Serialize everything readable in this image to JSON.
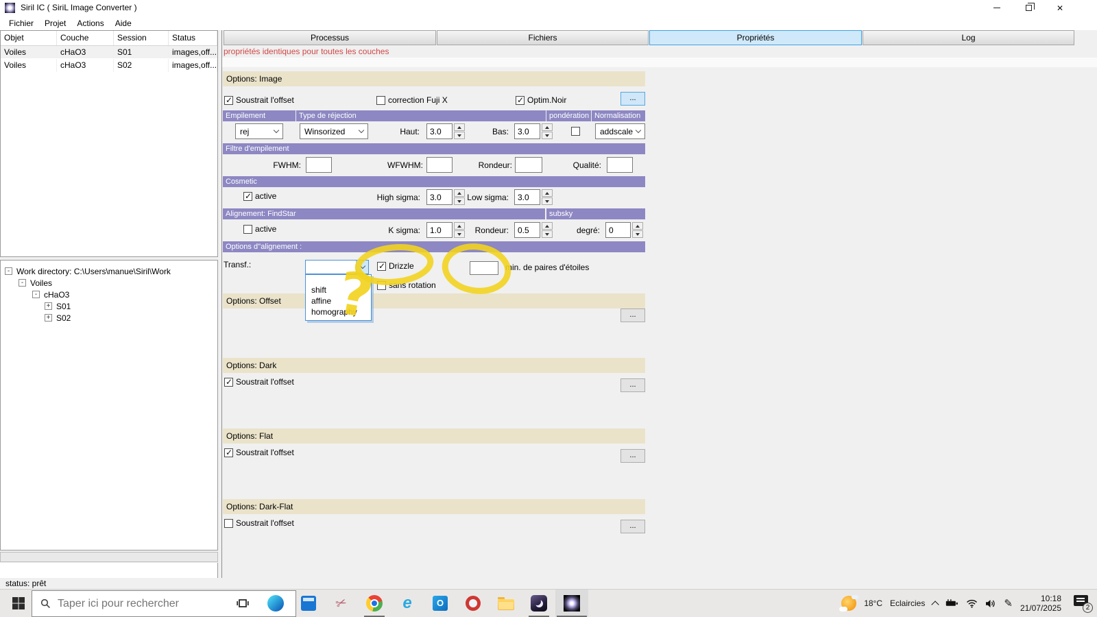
{
  "colors": {
    "purple_header": "#8d87c3",
    "tan_header": "#eae3ca",
    "tab_selected_bg": "#cfe9fb",
    "tab_selected_border": "#41a0e0",
    "notice_red": "#d14747",
    "annotation_yellow": "#f2d320"
  },
  "icons": {
    "check": "✓",
    "scissors": "✂",
    "pen": "✎",
    "ellipsis": "...",
    "tree_collapse": "-",
    "tree_expand": "+"
  },
  "window": {
    "title": "Siril IC  ( SiriL Image Converter )",
    "menu": [
      "Fichier",
      "Projet",
      "Actions",
      "Aide"
    ]
  },
  "left": {
    "table": {
      "columns": [
        "Objet",
        "Couche",
        "Session",
        "Status"
      ],
      "rows": [
        [
          "Voiles",
          "cHaO3",
          "S01",
          "images,off..."
        ],
        [
          "Voiles",
          "cHaO3",
          "S02",
          "images,off..."
        ]
      ]
    },
    "tree": [
      {
        "expander": "-",
        "label": "Work directory: C:\\Users\\manue\\Siril\\Work"
      },
      {
        "expander": "-",
        "label": "Voiles"
      },
      {
        "expander": "-",
        "label": "cHaO3"
      },
      {
        "expander": "+",
        "label": "S01"
      },
      {
        "expander": "+",
        "label": "S02"
      }
    ]
  },
  "tabs": [
    {
      "label": "Processus",
      "selected": false
    },
    {
      "label": "Fichiers",
      "selected": false
    },
    {
      "label": "Propriétés",
      "selected": true
    },
    {
      "label": "Log",
      "selected": false
    }
  ],
  "notice": "propriétés identiques pour toutes les couches",
  "image_options": {
    "header": "Options: Image",
    "subtract_offset": "Soustrait l'offset",
    "subtract_offset_checked": true,
    "fuji": "correction Fuji X",
    "fuji_checked": false,
    "optim_noir": "Optim.Noir",
    "optim_noir_checked": true,
    "more": "...",
    "stacking_header": "Empilement",
    "rejection_header": "Type de réjection",
    "weighting_header": "pondération",
    "weighting_checked": false,
    "normalisation_header": "Normalisation",
    "stacking_value": "rej",
    "rejection_value": "Winsorized",
    "high_label": "Haut:",
    "high_value": "3.0",
    "low_label": "Bas:",
    "low_value": "3.0",
    "normalisation_value": "addscale"
  },
  "stack_filter": {
    "header": "Filtre d'empilement",
    "fwhm_label": "FWHM:",
    "fwhm_value": "",
    "wfwhm_label": "WFWHM:",
    "wfwhm_value": "",
    "roundness_label": "Rondeur:",
    "roundness_value": "",
    "quality_label": "Qualité:",
    "quality_value": ""
  },
  "cosmetic": {
    "header": "Cosmetic",
    "active_label": "active",
    "active_checked": true,
    "high_sigma_label": "High sigma:",
    "high_sigma_value": "3.0",
    "low_sigma_label": "Low sigma:",
    "low_sigma_value": "3.0"
  },
  "findstar": {
    "header": "Alignement: FindStar",
    "subsky_header": "subsky",
    "active_label": "active",
    "active_checked": false,
    "ksigma_label": "K sigma:",
    "ksigma_value": "1.0",
    "roundness_label": "Rondeur:",
    "roundness_value": "0.5",
    "degree_label": "degré:",
    "degree_value": "0"
  },
  "align_options": {
    "header": "Options d''alignement :",
    "transf_label": "Transf.:",
    "transf_value": "",
    "dropdown_items": [
      "shift",
      "affine",
      "homography"
    ],
    "drizzle_label": "Drizzle",
    "drizzle_checked": true,
    "no_rotation_label": "sans rotation",
    "no_rotation_checked": false,
    "min_pairs_value": "",
    "min_pairs_label": "min. de paires d'étoiles"
  },
  "offset_options": {
    "header": "Options: Offset",
    "more": "..."
  },
  "dark_options": {
    "header": "Options: Dark",
    "subtract_offset": "Soustrait l'offset",
    "subtract_offset_checked": true,
    "more": "..."
  },
  "flat_options": {
    "header": "Options: Flat",
    "subtract_offset": "Soustrait l'offset",
    "subtract_offset_checked": true,
    "more": "..."
  },
  "darkflat_options": {
    "header": "Options: Dark-Flat",
    "subtract_offset": "Soustrait l'offset",
    "subtract_offset_checked": false,
    "more": "..."
  },
  "status_bar": {
    "text": "status: prêt"
  },
  "taskbar": {
    "search_placeholder": "Taper ici pour rechercher",
    "weather_temp": "18°C",
    "weather_condition": "Eclaircies",
    "time": "10:18",
    "date": "21/07/2025",
    "notification_badge": "2"
  }
}
